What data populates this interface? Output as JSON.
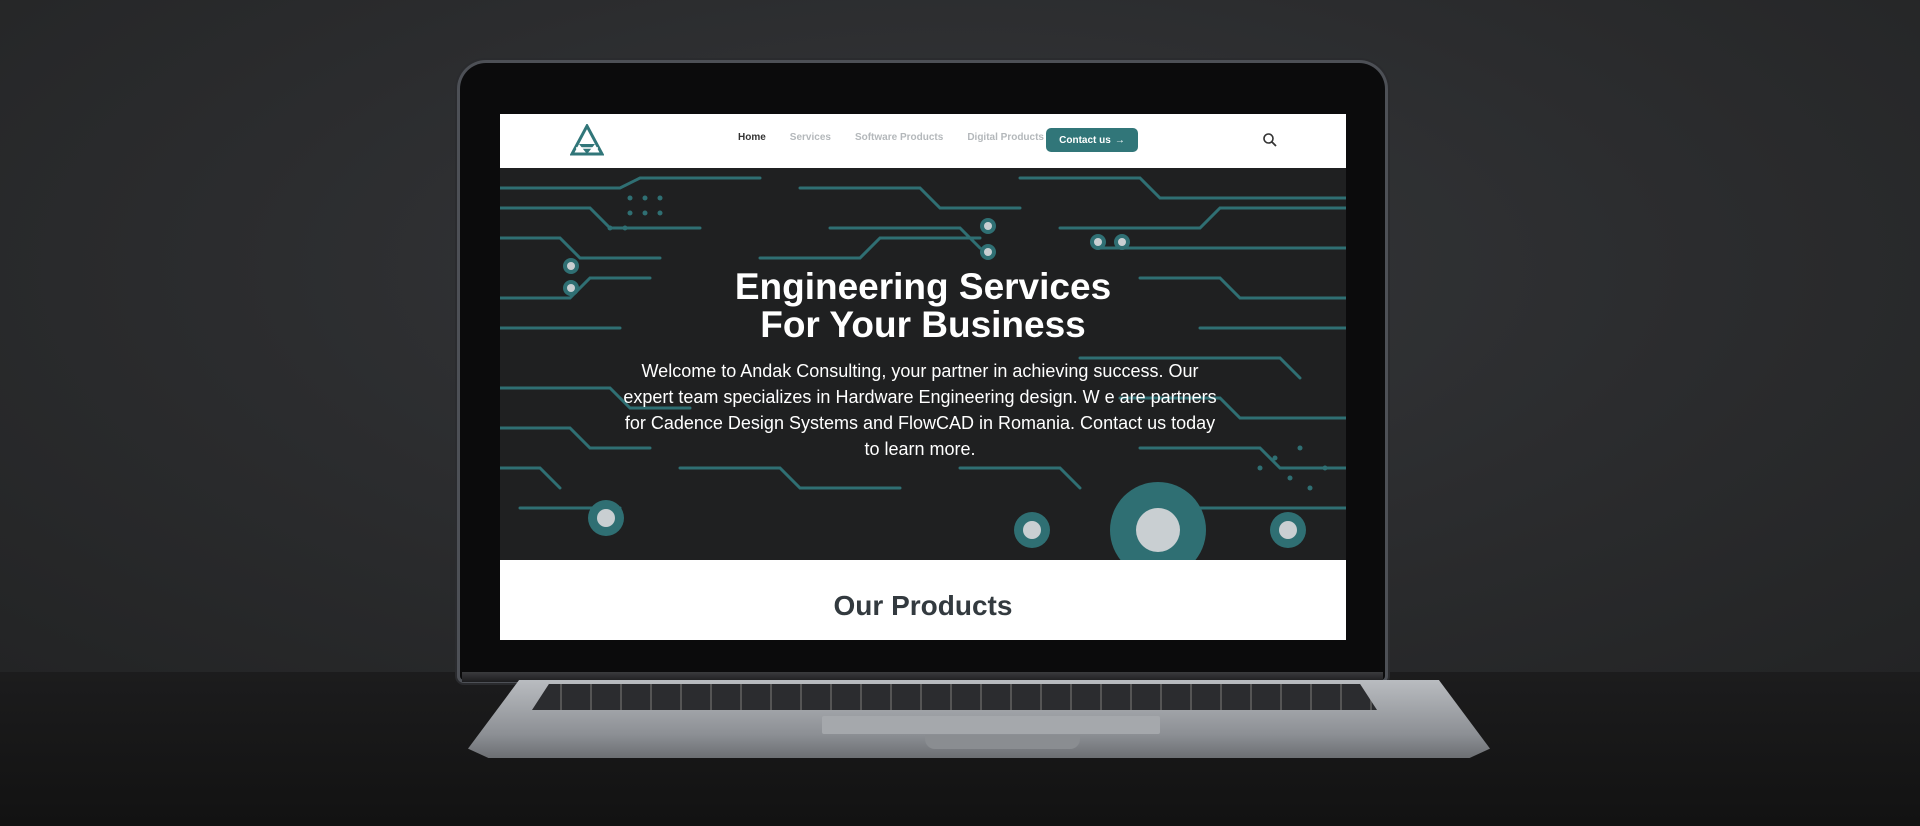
{
  "nav": {
    "items": [
      {
        "label": "Home"
      },
      {
        "label": "Services"
      },
      {
        "label": "Software Products"
      },
      {
        "label": "Digital Products"
      }
    ],
    "contact_label": "Contact us",
    "contact_arrow": "→"
  },
  "hero": {
    "title": "Engineering Services\nFor Your Business",
    "text": "Welcome to Andak Consulting, your partner in achieving success. Our expert team  specializes in Hardware Engineering design. W e are partners for Cadence Design Systems and FlowCAD in Romania.  Contact us today to learn more."
  },
  "products": {
    "title": "Our Products"
  },
  "colors": {
    "accent": "#317679",
    "hero_bg": "#1f2021",
    "nav_active": "#333333",
    "nav_muted": "#b4b8bb"
  },
  "icons": {
    "logo": "andak-triangle-logo",
    "search": "search-icon",
    "arrow": "arrow-right-icon"
  }
}
